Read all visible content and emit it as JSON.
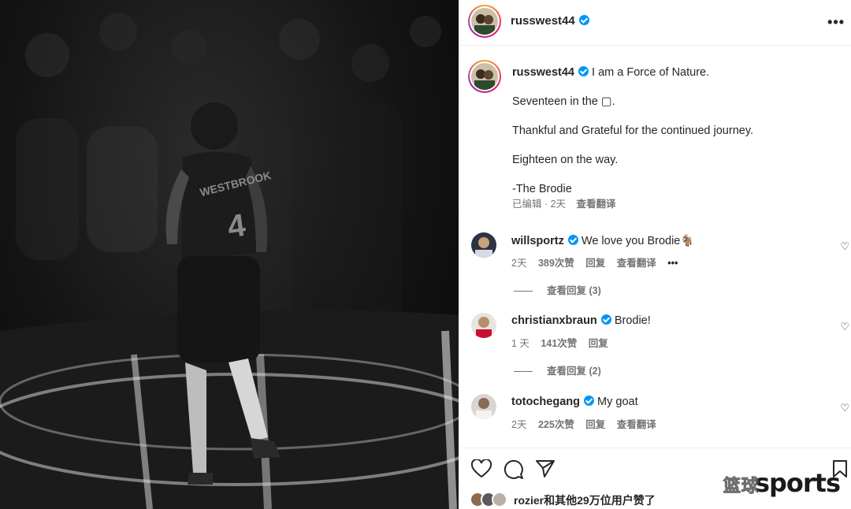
{
  "photo": {
    "jersey_name": "WESTBROOK",
    "jersey_number": "4"
  },
  "header": {
    "username": "russwest44",
    "more_label": "•••"
  },
  "caption": {
    "username": "russwest44",
    "lines": [
      "I am a Force of Nature.",
      "Seventeen in the ▢.",
      "Thankful and Grateful for the continued journey.",
      "Eighteen on the way.",
      "-The Brodie"
    ],
    "edited": "已编辑 · 2天",
    "translate": "查看翻译"
  },
  "comments": [
    {
      "username": "willsportz",
      "text": "We love you Brodie🐐",
      "time": "2天",
      "likes": "389次赞",
      "reply": "回复",
      "translate": "查看翻译",
      "more": "•••",
      "view_replies": "查看回复 (3)"
    },
    {
      "username": "christianxbraun",
      "text": "Brodie!",
      "time": "1 天",
      "likes": "141次赞",
      "reply": "回复",
      "translate": "",
      "more": "",
      "view_replies": "查看回复 (2)"
    },
    {
      "username": "totochegang",
      "text": "My goat",
      "time": "2天",
      "likes": "225次赞",
      "reply": "回复",
      "translate": "查看翻译",
      "more": "",
      "view_replies": ""
    }
  ],
  "actions": {
    "liked_by": "rozier和其他29万位用户赞了"
  },
  "watermark": {
    "cn": "篮球",
    "en": "sports"
  }
}
